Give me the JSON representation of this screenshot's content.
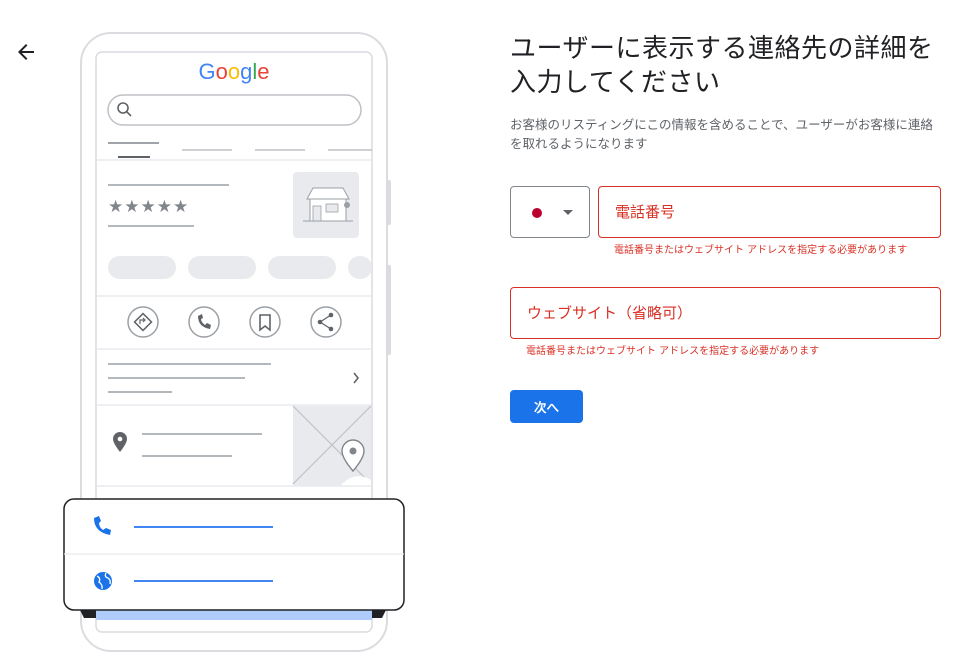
{
  "nav": {
    "back_icon": "arrow-left-icon"
  },
  "illustration": {
    "brand": [
      "G",
      "o",
      "o",
      "g",
      "l",
      "e"
    ],
    "brand_colors": [
      "#4285f4",
      "#ea4335",
      "#fbbc05",
      "#4285f4",
      "#34a853",
      "#ea4335"
    ],
    "stars": "★★★★★",
    "icons": [
      "directions-icon",
      "phone-icon",
      "bookmark-icon",
      "share-icon",
      "location-pin-icon",
      "store-icon",
      "globe-icon"
    ],
    "accent": "#4285f4"
  },
  "form": {
    "title": "ユーザーに表示する連絡先の詳細を入力してください",
    "description": "お客様のリスティングにこの情報を含めることで、ユーザーがお客様に連絡を取れるようになります",
    "country_flag_color": "#bc002d",
    "phone_placeholder": "電話番号",
    "phone_value": "",
    "phone_error": "電話番号またはウェブサイト アドレスを指定する必要があります",
    "website_placeholder": "ウェブサイト（省略可）",
    "website_value": "",
    "website_error": "電話番号またはウェブサイト アドレスを指定する必要があります",
    "next_label": "次へ",
    "error_color": "#d93025",
    "primary_color": "#1a73e8"
  }
}
